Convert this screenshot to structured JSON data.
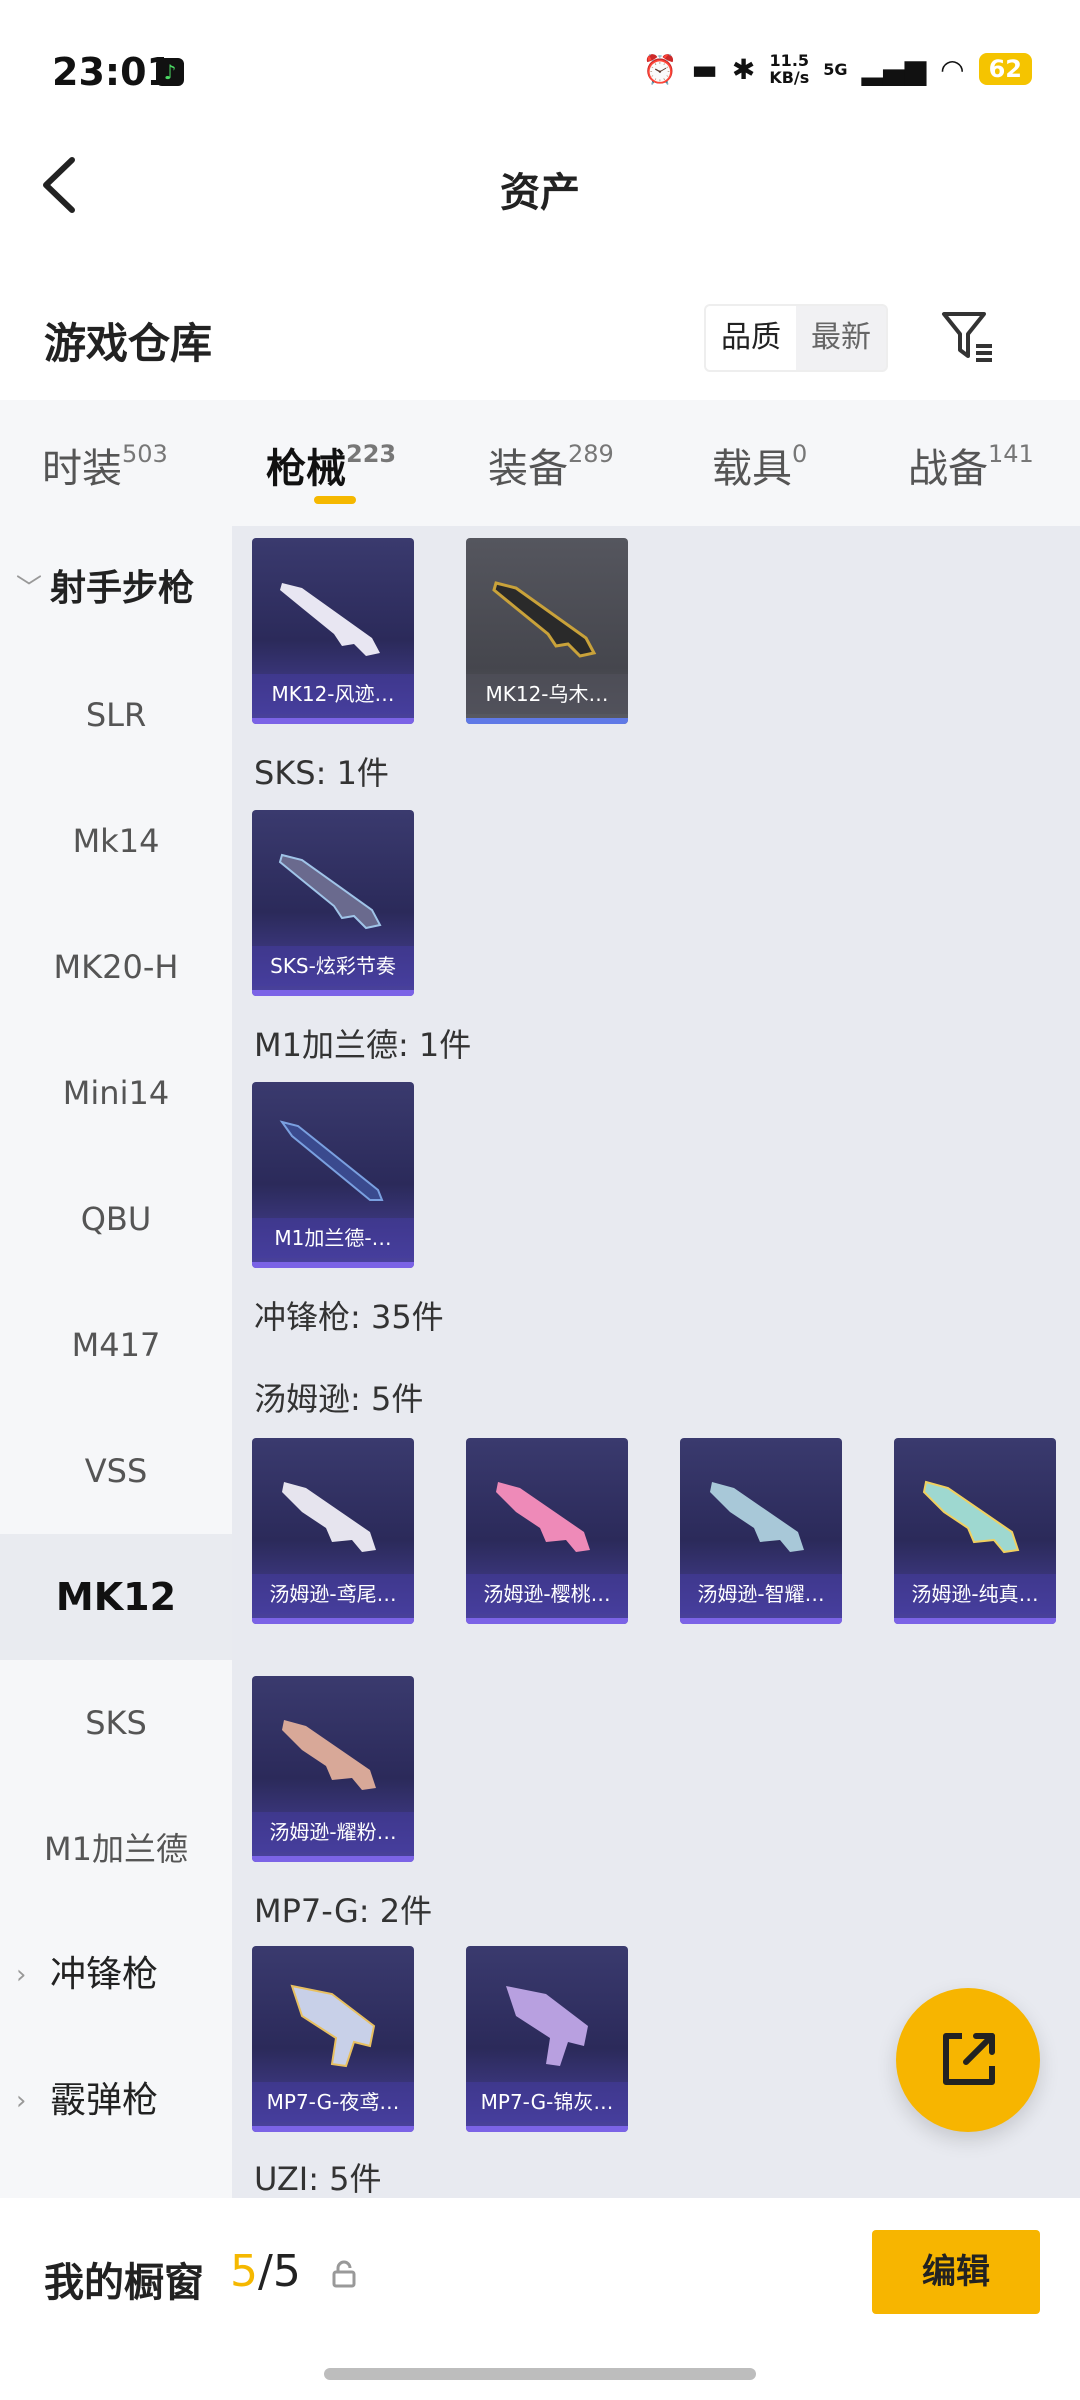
{
  "status_bar": {
    "time": "23:01",
    "net_speed_top": "11.5",
    "net_speed_bottom": "KB/s",
    "network": "5G",
    "battery": "62"
  },
  "header": {
    "title": "资产"
  },
  "warehouse": {
    "title": "游戏仓库",
    "sort_options": [
      "品质",
      "最新"
    ],
    "sort_active": "品质"
  },
  "tabs": [
    {
      "label": "时装",
      "count": "503"
    },
    {
      "label": "枪械",
      "count": "223"
    },
    {
      "label": "装备",
      "count": "289"
    },
    {
      "label": "载具",
      "count": "0"
    },
    {
      "label": "战备",
      "count": "141"
    }
  ],
  "sidebar": {
    "group_open": "射手步枪",
    "items": [
      "SLR",
      "Mk14",
      "MK20-H",
      "Mini14",
      "QBU",
      "M417",
      "VSS",
      "MK12",
      "SKS",
      "M1加兰德"
    ],
    "active": "MK12",
    "group_collapsed_1": "冲锋枪",
    "group_collapsed_2": "霰弹枪"
  },
  "content": {
    "mk12_items": [
      "MK12-风迹…",
      "MK12-乌木…"
    ],
    "sks_label": "SKS: 1件",
    "sks_items": [
      "SKS-炫彩节奏"
    ],
    "m1_label": "M1加兰德: 1件",
    "m1_items": [
      "M1加兰德-…"
    ],
    "smg_label": "冲锋枪: 35件",
    "tommy_label": "汤姆逊: 5件",
    "tommy_items": [
      "汤姆逊-鸢尾…",
      "汤姆逊-樱桃…",
      "汤姆逊-智耀…",
      "汤姆逊-纯真…",
      "汤姆逊-耀粉…"
    ],
    "mp7_label": "MP7-G: 2件",
    "mp7_items": [
      "MP7-G-夜鸢…",
      "MP7-G-锦灰…"
    ],
    "uzi_label": "UZI: 5件"
  },
  "bottom_bar": {
    "showcase_label": "我的橱窗",
    "showcase_current": "5",
    "showcase_sep_total": "/5",
    "edit_label": "编辑"
  },
  "colors": {
    "accent": "#f7b500",
    "card_purple": "#2b2a5a",
    "content_bg": "#e8eaf0"
  }
}
